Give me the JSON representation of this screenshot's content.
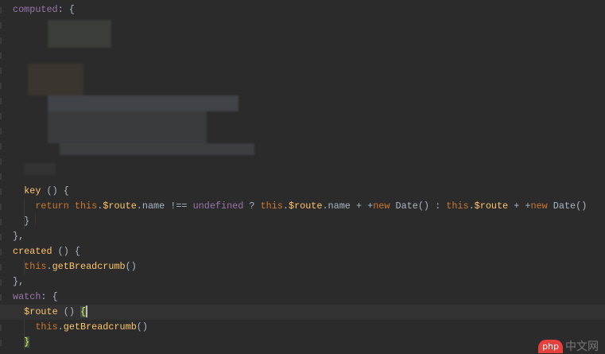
{
  "editor": {
    "lines": [
      [
        [
          "computed",
          "pr"
        ],
        [
          ": {",
          "pl"
        ]
      ],
      [],
      [],
      [],
      [],
      [],
      [],
      [],
      [],
      [],
      [],
      [],
      [
        [
          "  ",
          "pl"
        ],
        [
          "key",
          "fn"
        ],
        [
          " () {",
          "pl"
        ]
      ],
      [
        [
          "    ",
          "pl"
        ],
        [
          "return ",
          "kw"
        ],
        [
          "this",
          "th"
        ],
        [
          ".",
          "pl"
        ],
        [
          "$route",
          "fn"
        ],
        [
          ".name !== ",
          "pl"
        ],
        [
          "undefined",
          "pr"
        ],
        [
          " ? ",
          "pl"
        ],
        [
          "this",
          "th"
        ],
        [
          ".",
          "pl"
        ],
        [
          "$route",
          "fn"
        ],
        [
          ".name + +",
          "pl"
        ],
        [
          "new ",
          "kw"
        ],
        [
          "Date() : ",
          "pl"
        ],
        [
          "this",
          "th"
        ],
        [
          ".",
          "pl"
        ],
        [
          "$route",
          "fn"
        ],
        [
          " + +",
          "pl"
        ],
        [
          "new ",
          "kw"
        ],
        [
          "Date()",
          "pl"
        ]
      ],
      [
        [
          "  }",
          "pl"
        ]
      ],
      [
        [
          "},",
          "pl"
        ]
      ],
      [
        [
          "created",
          "fn"
        ],
        [
          " () {",
          "pl"
        ]
      ],
      [
        [
          "  ",
          "pl"
        ],
        [
          "this",
          "th"
        ],
        [
          ".",
          "pl"
        ],
        [
          "getBreadcrumb",
          "fn"
        ],
        [
          "()",
          "pl"
        ]
      ],
      [
        [
          "},",
          "pl"
        ]
      ],
      [
        [
          "watch",
          "pr"
        ],
        [
          ": {",
          "pl"
        ]
      ],
      [
        [
          "  ",
          "pl"
        ],
        [
          "$route",
          "fn"
        ],
        [
          " () ",
          "pl"
        ],
        [
          "{",
          "br"
        ]
      ],
      [
        [
          "    ",
          "pl"
        ],
        [
          "this",
          "th"
        ],
        [
          ".",
          "pl"
        ],
        [
          "getBreadcrumb",
          "fn"
        ],
        [
          "()",
          "pl"
        ]
      ],
      [
        [
          "  ",
          "pl"
        ],
        [
          "}",
          "br"
        ]
      ]
    ],
    "current_line": 20
  },
  "watermark": {
    "logo": "php",
    "text": "中文网"
  }
}
